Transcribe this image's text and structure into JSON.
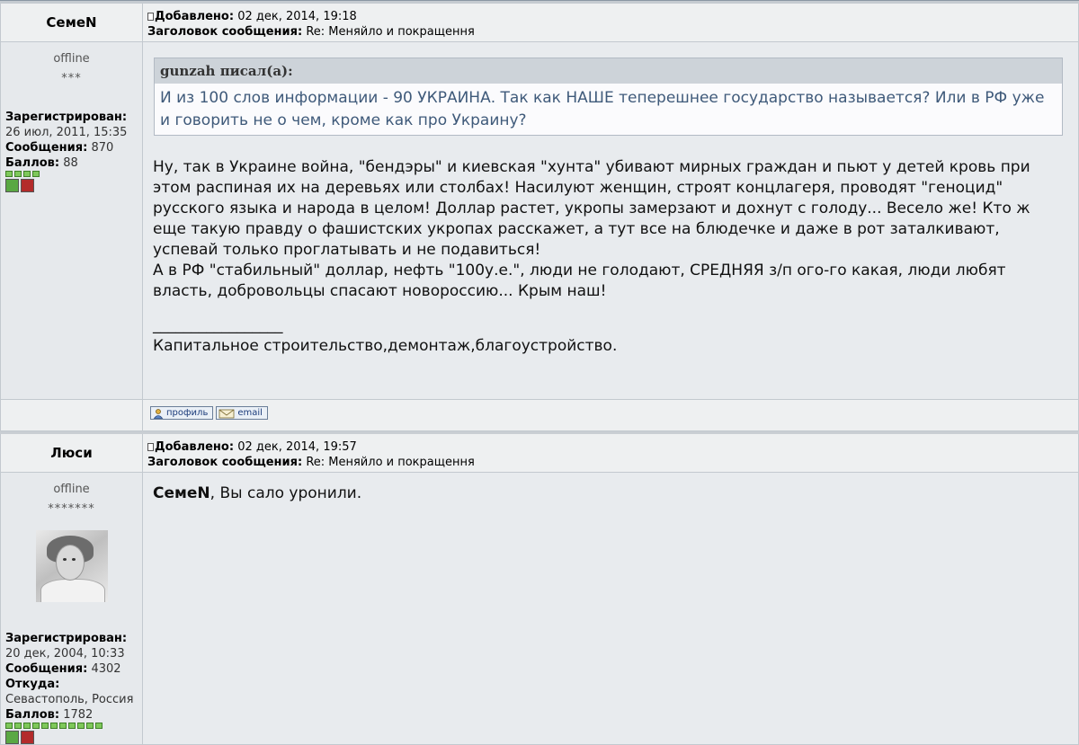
{
  "posts": [
    {
      "author": "СемеN",
      "meta": {
        "added_label": "Добавлено:",
        "added_value": "02 дек, 2014, 19:18",
        "subject_label": "Заголовок сообщения:",
        "subject_value": "Re: Меняйло и покращення"
      },
      "profile": {
        "status": "offline",
        "rank": "***",
        "registered_label": "Зарегистрирован:",
        "registered_value": "26 июл, 2011, 15:35",
        "messages_label": "Сообщения:",
        "messages_value": "870",
        "points_label": "Баллов:",
        "points_value": "88",
        "bar_cells": 4
      },
      "quote": {
        "author": "gunzah",
        "header_suffix": "писал(а):",
        "text": "И из 100 слов информации - 90 УКРАИНА. Так как НАШЕ теперешнее государство называется? Или в РФ уже и говорить не о чем, кроме как про Украину?"
      },
      "body": {
        "p1": "Ну, так в Украине война, \"бендэры\" и киевская \"хунта\" убивают мирных граждан и пьют у детей кровь при этом распиная их на деревьях или столбах! Насилуют женщин, строят концлагеря, проводят \"геноцид\" русского языка и народа в целом! Доллар растет, укропы замерзают и дохнут с голоду... Весело же! Кто ж еще такую правду о фашистских укропах расскажет, а тут все на блюдечке и даже в рот заталкивают, успевай только проглатывать и не подавиться!",
        "p2": "А в РФ \"стабильный\" доллар, нефть \"100у.е.\", люди не голодают, СРЕДНЯЯ з/п ого-го какая, люди любят власть, добровольцы спасают новороссию... Крым наш!",
        "sig_line": "_________________",
        "signature": "Капитальное строительство,демонтаж,благоустройство."
      },
      "buttons": {
        "profile": "профиль",
        "email": "email"
      }
    },
    {
      "author": "Люси",
      "meta": {
        "added_label": "Добавлено:",
        "added_value": "02 дек, 2014, 19:57",
        "subject_label": "Заголовок сообщения:",
        "subject_value": "Re: Меняйло и покращення"
      },
      "profile": {
        "status": "offline",
        "rank": "*******",
        "registered_label": "Зарегистрирован:",
        "registered_value": "20 дек, 2004, 10:33",
        "messages_label": "Сообщения:",
        "messages_value": "4302",
        "from_label": "Откуда:",
        "from_value": "Севастополь, Россия",
        "points_label": "Баллов:",
        "points_value": "1782",
        "bar_cells": 11
      },
      "body": {
        "mention": "СемеN",
        "text": ", Вы сало уронили."
      }
    }
  ],
  "colors": {
    "header_bg": "#eef0f1",
    "body_bg": "#e8ebee",
    "quote_text": "#3f5a7a",
    "bar_green": "#7ec85a"
  }
}
